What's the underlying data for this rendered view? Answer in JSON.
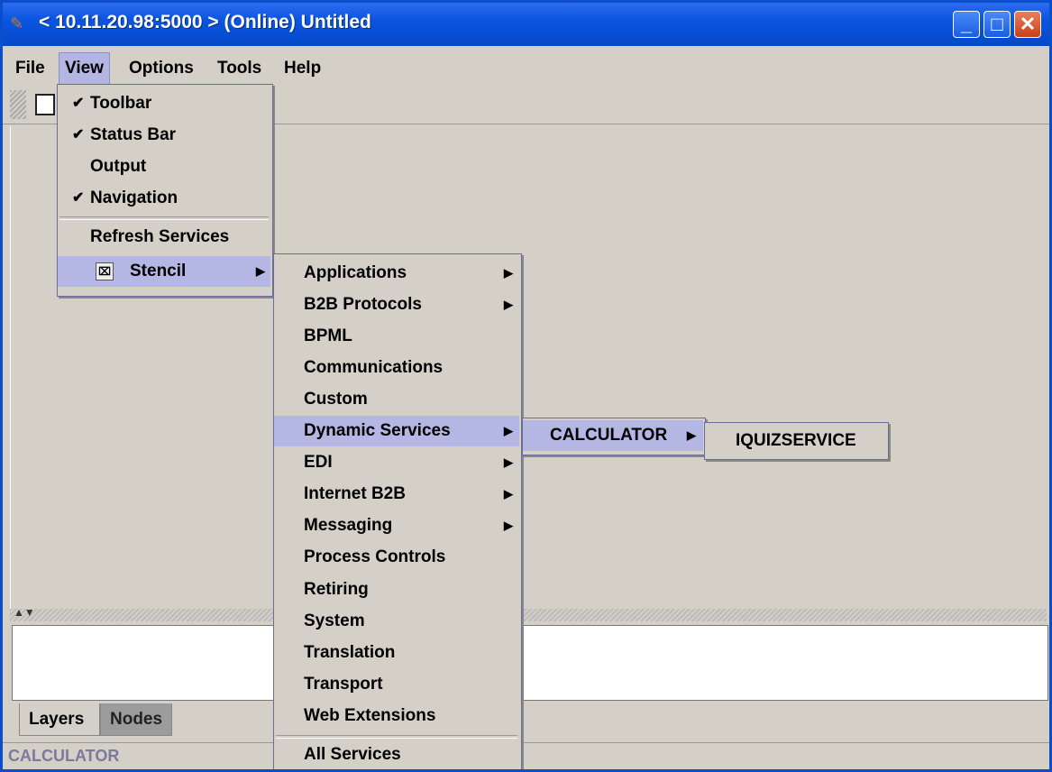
{
  "window": {
    "title": "< 10.11.20.98:5000 > (Online) Untitled",
    "icon": "app-icon",
    "controls": {
      "minimize": "minimize-icon",
      "maximize": "maximize-icon",
      "close": "close-icon"
    }
  },
  "menubar": {
    "items": [
      "File",
      "View",
      "Options",
      "Tools",
      "Help"
    ],
    "active": "View"
  },
  "view_menu": {
    "items": [
      {
        "label": "Toolbar",
        "checked": true
      },
      {
        "label": "Status Bar",
        "checked": true
      },
      {
        "label": "Output",
        "checked": false
      },
      {
        "label": "Navigation",
        "checked": true
      },
      {
        "label": "Refresh Services",
        "checked": false
      },
      {
        "label": "Stencil",
        "checked": false
      }
    ]
  },
  "stencil_menu": {
    "items": [
      "Applications",
      "B2B Protocols",
      "BPML",
      "Communications",
      "Custom",
      "Dynamic Services",
      "EDI",
      "Internet B2B",
      "Messaging",
      "Process Controls",
      "Retiring",
      "System",
      "Translation",
      "Transport",
      "Web Extensions",
      "All Services"
    ],
    "highlighted": "Dynamic Services"
  },
  "dynamic_menu": {
    "items": [
      "CALCULATOR"
    ]
  },
  "calculator_menu": {
    "items": [
      "IQUIZSERVICE"
    ]
  },
  "tabs": [
    "Layers",
    "Nodes"
  ],
  "status": {
    "text": "CALCULATOR"
  },
  "colors": {
    "title_bar": "#0a55e0",
    "menu_highlight": "#b4b6e4",
    "face": "#d4d0c8"
  }
}
